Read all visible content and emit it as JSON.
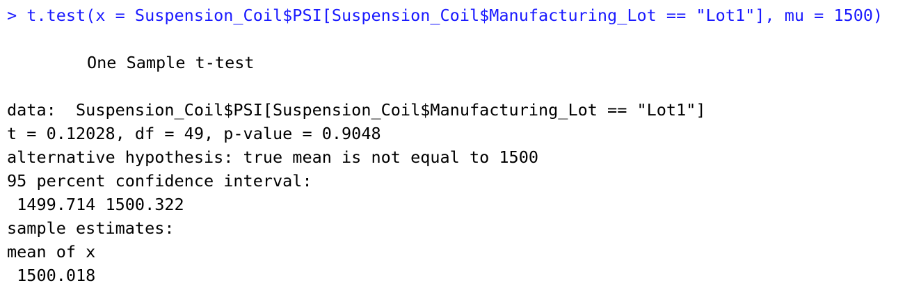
{
  "console": {
    "prompt": "> ",
    "command": "t.test(x = Suspension_Coil$PSI[Suspension_Coil$Manufacturing_Lot == \"Lot1\"], mu = 1500)",
    "output": {
      "title": "One Sample t-test",
      "data_line": "data:  Suspension_Coil$PSI[Suspension_Coil$Manufacturing_Lot == \"Lot1\"]",
      "stats_line": "t = 0.12028, df = 49, p-value = 0.9048",
      "alternative_line": "alternative hypothesis: true mean is not equal to 1500",
      "ci_label": "95 percent confidence interval:",
      "ci_values": " 1499.714 1500.322",
      "estimates_label": "sample estimates:",
      "estimates_header": "mean of x",
      "estimates_value": " 1500.018"
    },
    "colors": {
      "command": "#1a1aff",
      "output": "#000000",
      "background": "#ffffff"
    }
  }
}
